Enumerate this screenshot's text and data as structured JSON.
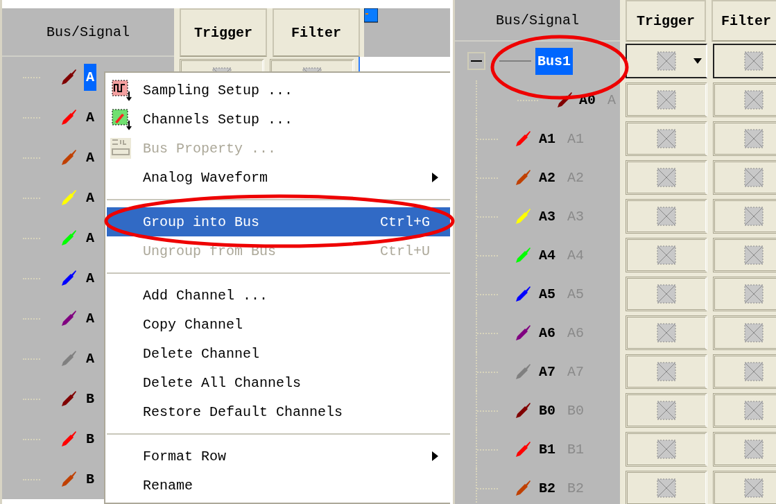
{
  "left_panel": {
    "columns": [
      "Bus/Signal",
      "Trigger",
      "Filter"
    ],
    "signals": [
      {
        "label": "A",
        "color": "#800000",
        "selected": true
      },
      {
        "label": "A",
        "color": "#ff0000",
        "selected": false
      },
      {
        "label": "A",
        "color": "#c04000",
        "selected": false
      },
      {
        "label": "A",
        "color": "#ffff00",
        "selected": false
      },
      {
        "label": "A",
        "color": "#00ff00",
        "selected": false
      },
      {
        "label": "A",
        "color": "#0000ff",
        "selected": false
      },
      {
        "label": "A",
        "color": "#800080",
        "selected": false
      },
      {
        "label": "A",
        "color": "#808080",
        "selected": false
      },
      {
        "label": "B",
        "color": "#800000",
        "selected": false
      },
      {
        "label": "B",
        "color": "#ff0000",
        "selected": false
      },
      {
        "label": "B",
        "color": "#c04000",
        "selected": false
      }
    ],
    "context_menu": [
      {
        "kind": "item",
        "label": "Sampling Setup ...",
        "disabled": false,
        "selected": false
      },
      {
        "kind": "item",
        "label": "Channels Setup ...",
        "disabled": false,
        "selected": false
      },
      {
        "kind": "item",
        "label": "Bus Property ...",
        "disabled": true,
        "selected": false
      },
      {
        "kind": "submenu",
        "label": "Analog Waveform",
        "disabled": false,
        "selected": false
      },
      {
        "kind": "separator"
      },
      {
        "kind": "item",
        "label": "Group into Bus",
        "shortcut": "Ctrl+G",
        "disabled": false,
        "selected": true
      },
      {
        "kind": "item",
        "label": "Ungroup from Bus",
        "shortcut": "Ctrl+U",
        "disabled": true,
        "selected": false
      },
      {
        "kind": "separator"
      },
      {
        "kind": "item",
        "label": "Add Channel ...",
        "disabled": false,
        "selected": false
      },
      {
        "kind": "item",
        "label": "Copy Channel",
        "disabled": false,
        "selected": false
      },
      {
        "kind": "item",
        "label": "Delete Channel",
        "disabled": false,
        "selected": false
      },
      {
        "kind": "item",
        "label": "Delete All Channels",
        "disabled": false,
        "selected": false
      },
      {
        "kind": "item",
        "label": "Restore Default Channels",
        "disabled": false,
        "selected": false
      },
      {
        "kind": "separator"
      },
      {
        "kind": "submenu",
        "label": "Format Row",
        "disabled": false,
        "selected": false
      },
      {
        "kind": "item",
        "label": "Rename",
        "disabled": false,
        "selected": false
      }
    ]
  },
  "right_panel": {
    "columns": [
      "Bus/Signal",
      "Trigger",
      "Filter"
    ],
    "tree": [
      {
        "label": "Bus1",
        "selected": true,
        "expanded": true,
        "children": [
          {
            "label": "A0",
            "alias": "A",
            "color": "#800000"
          }
        ]
      },
      {
        "label": "A1",
        "alias": "A1",
        "color": "#ff0000"
      },
      {
        "label": "A2",
        "alias": "A2",
        "color": "#c04000"
      },
      {
        "label": "A3",
        "alias": "A3",
        "color": "#ffff00"
      },
      {
        "label": "A4",
        "alias": "A4",
        "color": "#00ff00"
      },
      {
        "label": "A5",
        "alias": "A5",
        "color": "#0000ff"
      },
      {
        "label": "A6",
        "alias": "A6",
        "color": "#800080"
      },
      {
        "label": "A7",
        "alias": "A7",
        "color": "#808080"
      },
      {
        "label": "B0",
        "alias": "B0",
        "color": "#800000"
      },
      {
        "label": "B1",
        "alias": "B1",
        "color": "#ff0000"
      },
      {
        "label": "B2",
        "alias": "B2",
        "color": "#c04000"
      }
    ]
  }
}
